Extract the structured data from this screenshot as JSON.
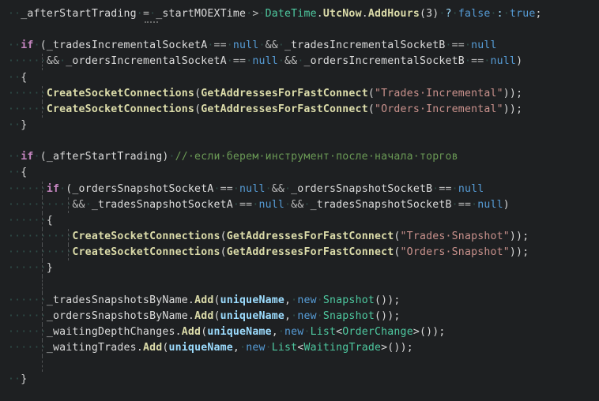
{
  "editor": {
    "background": "#1e2022",
    "language": "csharp",
    "indent_guide_color": "#5a5c5e",
    "whitespace_dot_color": "#2f4f4a",
    "font_size_px": 13.2,
    "line_height_px": 20.15
  },
  "palette": {
    "default": "#dcdcdc",
    "keyword_control": "#c586c0",
    "keyword_blue": "#569cd6",
    "type": "#4ec9a0",
    "method": "#dcdcaa",
    "string": "#c9918c",
    "comment": "#6a9955",
    "field": "#9cdcfe",
    "operator": "#b9b9b9"
  },
  "code": {
    "language_label": "C#",
    "lines": [
      {
        "n": 1,
        "indent": 2,
        "text": "_afterStartTrading = _startMOEXTime > DateTime.UtcNow.AddHours(3) ? false : true;",
        "guides": [],
        "has_squiggle": true,
        "tokens": [
          {
            "t": "_afterStartTrading",
            "c": "plain"
          },
          {
            "t": " ",
            "c": "ws"
          },
          {
            "t": "=",
            "c": "op"
          },
          {
            "t": " ",
            "c": "ws"
          },
          {
            "t": "_startMOEXTime",
            "c": "plain"
          },
          {
            "t": " ",
            "c": "ws"
          },
          {
            "t": ">",
            "c": "op"
          },
          {
            "t": " ",
            "c": "ws"
          },
          {
            "t": "DateTime",
            "c": "type"
          },
          {
            "t": ".",
            "c": "punct"
          },
          {
            "t": "UtcNow",
            "c": "method"
          },
          {
            "t": ".",
            "c": "punct"
          },
          {
            "t": "AddHours",
            "c": "method"
          },
          {
            "t": "(",
            "c": "punct"
          },
          {
            "t": "3",
            "c": "num"
          },
          {
            "t": ")",
            "c": "punct"
          },
          {
            "t": " ",
            "c": "ws"
          },
          {
            "t": "?",
            "c": "ternary"
          },
          {
            "t": " ",
            "c": "ws"
          },
          {
            "t": "false",
            "c": "kwblue"
          },
          {
            "t": " ",
            "c": "ws"
          },
          {
            "t": ":",
            "c": "ternary"
          },
          {
            "t": " ",
            "c": "ws"
          },
          {
            "t": "true",
            "c": "kwblue"
          },
          {
            "t": ";",
            "c": "punct"
          }
        ]
      },
      {
        "n": 2,
        "indent": 0,
        "text": "",
        "guides": [],
        "tokens": []
      },
      {
        "n": 3,
        "indent": 2,
        "text": "if (_tradesIncrementalSocketA == null && _tradesIncrementalSocketB == null",
        "guides": [],
        "tokens": [
          {
            "t": "if",
            "c": "kw"
          },
          {
            "t": " ",
            "c": "ws"
          },
          {
            "t": "(",
            "c": "punct"
          },
          {
            "t": "_tradesIncrementalSocketA",
            "c": "plain"
          },
          {
            "t": " ",
            "c": "ws"
          },
          {
            "t": "==",
            "c": "op"
          },
          {
            "t": " ",
            "c": "ws"
          },
          {
            "t": "null",
            "c": "kwblue"
          },
          {
            "t": " ",
            "c": "ws"
          },
          {
            "t": "&&",
            "c": "op"
          },
          {
            "t": " ",
            "c": "ws"
          },
          {
            "t": "_tradesIncrementalSocketB",
            "c": "plain"
          },
          {
            "t": " ",
            "c": "ws"
          },
          {
            "t": "==",
            "c": "op"
          },
          {
            "t": " ",
            "c": "ws"
          },
          {
            "t": "null",
            "c": "kwblue"
          }
        ]
      },
      {
        "n": 4,
        "indent": 6,
        "text": "&& _ordersIncrementalSocketA == null && _ordersIncrementalSocketB == null)",
        "guides": [
          53
        ],
        "tokens": [
          {
            "t": "&&",
            "c": "op"
          },
          {
            "t": " ",
            "c": "ws"
          },
          {
            "t": "_ordersIncrementalSocketA",
            "c": "plain"
          },
          {
            "t": " ",
            "c": "ws"
          },
          {
            "t": "==",
            "c": "op"
          },
          {
            "t": " ",
            "c": "ws"
          },
          {
            "t": "null",
            "c": "kwblue"
          },
          {
            "t": " ",
            "c": "ws"
          },
          {
            "t": "&&",
            "c": "op"
          },
          {
            "t": " ",
            "c": "ws"
          },
          {
            "t": "_ordersIncrementalSocketB",
            "c": "plain"
          },
          {
            "t": " ",
            "c": "ws"
          },
          {
            "t": "==",
            "c": "op"
          },
          {
            "t": " ",
            "c": "ws"
          },
          {
            "t": "null",
            "c": "kwblue"
          },
          {
            "t": ")",
            "c": "punct"
          }
        ]
      },
      {
        "n": 5,
        "indent": 2,
        "text": "{",
        "guides": [],
        "tokens": [
          {
            "t": "{",
            "c": "brace"
          }
        ]
      },
      {
        "n": 6,
        "indent": 6,
        "text": "CreateSocketConnections(GetAddressesForFastConnect(\"Trades Incremental\"));",
        "guides": [
          53
        ],
        "tokens": [
          {
            "t": "CreateSocketConnections",
            "c": "method"
          },
          {
            "t": "(",
            "c": "punct"
          },
          {
            "t": "GetAddressesForFastConnect",
            "c": "method"
          },
          {
            "t": "(",
            "c": "punct"
          },
          {
            "t": "\"Trades Incremental\"",
            "c": "str"
          },
          {
            "t": "))",
            "c": "punct"
          },
          {
            "t": ";",
            "c": "punct"
          }
        ]
      },
      {
        "n": 7,
        "indent": 6,
        "text": "CreateSocketConnections(GetAddressesForFastConnect(\"Orders Incremental\"));",
        "guides": [
          53
        ],
        "tokens": [
          {
            "t": "CreateSocketConnections",
            "c": "method"
          },
          {
            "t": "(",
            "c": "punct"
          },
          {
            "t": "GetAddressesForFastConnect",
            "c": "method"
          },
          {
            "t": "(",
            "c": "punct"
          },
          {
            "t": "\"Orders Incremental\"",
            "c": "str"
          },
          {
            "t": "))",
            "c": "punct"
          },
          {
            "t": ";",
            "c": "punct"
          }
        ]
      },
      {
        "n": 8,
        "indent": 2,
        "text": "}",
        "guides": [],
        "tokens": [
          {
            "t": "}",
            "c": "brace"
          }
        ]
      },
      {
        "n": 9,
        "indent": 0,
        "text": "",
        "guides": [],
        "tokens": []
      },
      {
        "n": 10,
        "indent": 2,
        "text": "if (_afterStartTrading) // если берем инструмент после начала торгов",
        "guides": [],
        "tokens": [
          {
            "t": "if",
            "c": "kw"
          },
          {
            "t": " ",
            "c": "ws"
          },
          {
            "t": "(",
            "c": "punct"
          },
          {
            "t": "_afterStartTrading",
            "c": "plain"
          },
          {
            "t": ")",
            "c": "punct"
          },
          {
            "t": " ",
            "c": "ws"
          },
          {
            "t": "// если берем инструмент после начала торгов",
            "c": "cmt"
          }
        ]
      },
      {
        "n": 11,
        "indent": 2,
        "text": "{",
        "guides": [],
        "tokens": [
          {
            "t": "{",
            "c": "brace"
          }
        ]
      },
      {
        "n": 12,
        "indent": 6,
        "text": "if (_ordersSnapshotSocketA == null && _ordersSnapshotSocketB == null",
        "guides": [
          53
        ],
        "tokens": [
          {
            "t": "if",
            "c": "kw"
          },
          {
            "t": " ",
            "c": "ws"
          },
          {
            "t": "(",
            "c": "punct"
          },
          {
            "t": "_ordersSnapshotSocketA",
            "c": "plain"
          },
          {
            "t": " ",
            "c": "ws"
          },
          {
            "t": "==",
            "c": "op"
          },
          {
            "t": " ",
            "c": "ws"
          },
          {
            "t": "null",
            "c": "kwblue"
          },
          {
            "t": " ",
            "c": "ws"
          },
          {
            "t": "&&",
            "c": "op"
          },
          {
            "t": " ",
            "c": "ws"
          },
          {
            "t": "_ordersSnapshotSocketB",
            "c": "plain"
          },
          {
            "t": " ",
            "c": "ws"
          },
          {
            "t": "==",
            "c": "op"
          },
          {
            "t": " ",
            "c": "ws"
          },
          {
            "t": "null",
            "c": "kwblue"
          }
        ]
      },
      {
        "n": 13,
        "indent": 10,
        "text": "&& _tradesSnapshotSocketA == null && _tradesSnapshotSocketB == null)",
        "guides": [
          53,
          86
        ],
        "tokens": [
          {
            "t": "&&",
            "c": "op"
          },
          {
            "t": " ",
            "c": "ws"
          },
          {
            "t": "_tradesSnapshotSocketA",
            "c": "plain"
          },
          {
            "t": " ",
            "c": "ws"
          },
          {
            "t": "==",
            "c": "op"
          },
          {
            "t": " ",
            "c": "ws"
          },
          {
            "t": "null",
            "c": "kwblue"
          },
          {
            "t": " ",
            "c": "ws"
          },
          {
            "t": "&&",
            "c": "op"
          },
          {
            "t": " ",
            "c": "ws"
          },
          {
            "t": "_tradesSnapshotSocketB",
            "c": "plain"
          },
          {
            "t": " ",
            "c": "ws"
          },
          {
            "t": "==",
            "c": "op"
          },
          {
            "t": " ",
            "c": "ws"
          },
          {
            "t": "null",
            "c": "kwblue"
          },
          {
            "t": ")",
            "c": "punct"
          }
        ]
      },
      {
        "n": 14,
        "indent": 6,
        "text": "{",
        "guides": [
          53
        ],
        "tokens": [
          {
            "t": "{",
            "c": "brace"
          }
        ]
      },
      {
        "n": 15,
        "indent": 10,
        "text": "CreateSocketConnections(GetAddressesForFastConnect(\"Trades Snapshot\"));",
        "guides": [
          53,
          86
        ],
        "tokens": [
          {
            "t": "CreateSocketConnections",
            "c": "method"
          },
          {
            "t": "(",
            "c": "punct"
          },
          {
            "t": "GetAddressesForFastConnect",
            "c": "method"
          },
          {
            "t": "(",
            "c": "punct"
          },
          {
            "t": "\"Trades Snapshot\"",
            "c": "str"
          },
          {
            "t": "))",
            "c": "punct"
          },
          {
            "t": ";",
            "c": "punct"
          }
        ]
      },
      {
        "n": 16,
        "indent": 10,
        "text": "CreateSocketConnections(GetAddressesForFastConnect(\"Orders Snapshot\"));",
        "guides": [
          53,
          86
        ],
        "tokens": [
          {
            "t": "CreateSocketConnections",
            "c": "method"
          },
          {
            "t": "(",
            "c": "punct"
          },
          {
            "t": "GetAddressesForFastConnect",
            "c": "method"
          },
          {
            "t": "(",
            "c": "punct"
          },
          {
            "t": "\"Orders Snapshot\"",
            "c": "str"
          },
          {
            "t": "))",
            "c": "punct"
          },
          {
            "t": ";",
            "c": "punct"
          }
        ]
      },
      {
        "n": 17,
        "indent": 6,
        "text": "}",
        "guides": [
          53
        ],
        "tokens": [
          {
            "t": "}",
            "c": "brace"
          }
        ]
      },
      {
        "n": 18,
        "indent": 0,
        "text": "",
        "guides": [
          53
        ],
        "tokens": []
      },
      {
        "n": 19,
        "indent": 6,
        "text": "_tradesSnapshotsByName.Add(uniqueName, new Snapshot());",
        "guides": [
          53
        ],
        "tokens": [
          {
            "t": "_tradesSnapshotsByName",
            "c": "plain"
          },
          {
            "t": ".",
            "c": "punct"
          },
          {
            "t": "Add",
            "c": "method"
          },
          {
            "t": "(",
            "c": "punct"
          },
          {
            "t": "uniqueName",
            "c": "field"
          },
          {
            "t": ",",
            "c": "punct"
          },
          {
            "t": " ",
            "c": "ws"
          },
          {
            "t": "new",
            "c": "kwblue"
          },
          {
            "t": " ",
            "c": "ws"
          },
          {
            "t": "Snapshot",
            "c": "type"
          },
          {
            "t": "())",
            "c": "punct"
          },
          {
            "t": ";",
            "c": "punct"
          }
        ]
      },
      {
        "n": 20,
        "indent": 6,
        "text": "_ordersSnapshotsByName.Add(uniqueName, new Snapshot());",
        "guides": [
          53
        ],
        "tokens": [
          {
            "t": "_ordersSnapshotsByName",
            "c": "plain"
          },
          {
            "t": ".",
            "c": "punct"
          },
          {
            "t": "Add",
            "c": "method"
          },
          {
            "t": "(",
            "c": "punct"
          },
          {
            "t": "uniqueName",
            "c": "field"
          },
          {
            "t": ",",
            "c": "punct"
          },
          {
            "t": " ",
            "c": "ws"
          },
          {
            "t": "new",
            "c": "kwblue"
          },
          {
            "t": " ",
            "c": "ws"
          },
          {
            "t": "Snapshot",
            "c": "type"
          },
          {
            "t": "())",
            "c": "punct"
          },
          {
            "t": ";",
            "c": "punct"
          }
        ]
      },
      {
        "n": 21,
        "indent": 6,
        "text": "_waitingDepthChanges.Add(uniqueName, new List<OrderChange>());",
        "guides": [
          53
        ],
        "tokens": [
          {
            "t": "_waitingDepthChanges",
            "c": "plain"
          },
          {
            "t": ".",
            "c": "punct"
          },
          {
            "t": "Add",
            "c": "method"
          },
          {
            "t": "(",
            "c": "punct"
          },
          {
            "t": "uniqueName",
            "c": "field"
          },
          {
            "t": ",",
            "c": "punct"
          },
          {
            "t": " ",
            "c": "ws"
          },
          {
            "t": "new",
            "c": "kwblue"
          },
          {
            "t": " ",
            "c": "ws"
          },
          {
            "t": "List",
            "c": "type"
          },
          {
            "t": "<",
            "c": "punct"
          },
          {
            "t": "OrderChange",
            "c": "type"
          },
          {
            "t": ">",
            "c": "punct"
          },
          {
            "t": "())",
            "c": "punct"
          },
          {
            "t": ";",
            "c": "punct"
          }
        ]
      },
      {
        "n": 22,
        "indent": 6,
        "text": "_waitingTrades.Add(uniqueName, new List<WaitingTrade>());",
        "guides": [
          53
        ],
        "tokens": [
          {
            "t": "_waitingTrades",
            "c": "plain"
          },
          {
            "t": ".",
            "c": "punct"
          },
          {
            "t": "Add",
            "c": "method"
          },
          {
            "t": "(",
            "c": "punct"
          },
          {
            "t": "uniqueName",
            "c": "field"
          },
          {
            "t": ",",
            "c": "punct"
          },
          {
            "t": " ",
            "c": "ws"
          },
          {
            "t": "new",
            "c": "kwblue"
          },
          {
            "t": " ",
            "c": "ws"
          },
          {
            "t": "List",
            "c": "type"
          },
          {
            "t": "<",
            "c": "punct"
          },
          {
            "t": "WaitingTrade",
            "c": "type"
          },
          {
            "t": ">",
            "c": "punct"
          },
          {
            "t": "())",
            "c": "punct"
          },
          {
            "t": ";",
            "c": "punct"
          }
        ]
      },
      {
        "n": 23,
        "indent": 0,
        "text": "",
        "guides": [
          53
        ],
        "tokens": []
      },
      {
        "n": 24,
        "indent": 2,
        "text": "}",
        "guides": [],
        "tokens": [
          {
            "t": "}",
            "c": "brace"
          }
        ]
      }
    ]
  }
}
